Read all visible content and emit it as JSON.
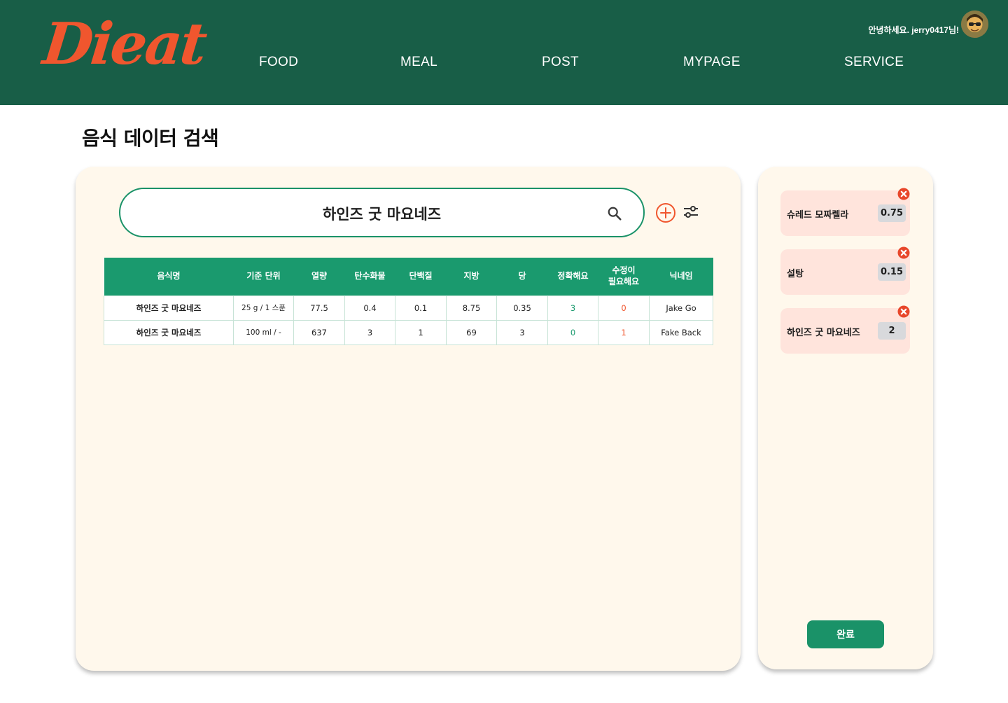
{
  "brand": {
    "logo_text": "Dieat",
    "logo_color": "#f0562e",
    "header_color": "#185e47"
  },
  "nav": {
    "items": [
      "FOOD",
      "MEAL",
      "POST",
      "MYPAGE",
      "SERVICE"
    ]
  },
  "user": {
    "greeting": "안녕하세요. jerry0417님!"
  },
  "page": {
    "title": "음식 데이터 검색"
  },
  "search": {
    "query": "하인즈 굿 마요네즈"
  },
  "table": {
    "headers": [
      "음식명",
      "기준 단위",
      "열량",
      "탄수화물",
      "단백질",
      "지방",
      "당",
      "정확해요",
      "수정이 필요해요",
      "닉네임"
    ],
    "rows": [
      {
        "name": "하인즈 굿 마요네즈",
        "unit": "25 g / 1 스푼",
        "kcal": "77.5",
        "carb": "0.4",
        "protein": "0.1",
        "fat": "8.75",
        "sugar": "0.35",
        "accurate": "3",
        "needs_fix": "0",
        "nickname": "Jake Go"
      },
      {
        "name": "하인즈 굿 마요네즈",
        "unit": "100 ml / -",
        "kcal": "637",
        "carb": "3",
        "protein": "1",
        "fat": "69",
        "sugar": "3",
        "accurate": "0",
        "needs_fix": "1",
        "nickname": "Fake Back"
      }
    ]
  },
  "cart": {
    "items": [
      {
        "name": "슈레드 모짜렐라",
        "qty": "0.75"
      },
      {
        "name": "설탕",
        "qty": "0.15"
      },
      {
        "name": "하인즈 굿 마요네즈",
        "qty": "2"
      }
    ],
    "done_label": "완료"
  },
  "icons": {
    "search": "search-icon",
    "add": "plus-circle-icon",
    "filter": "sliders-icon",
    "remove": "close-circle-icon"
  }
}
